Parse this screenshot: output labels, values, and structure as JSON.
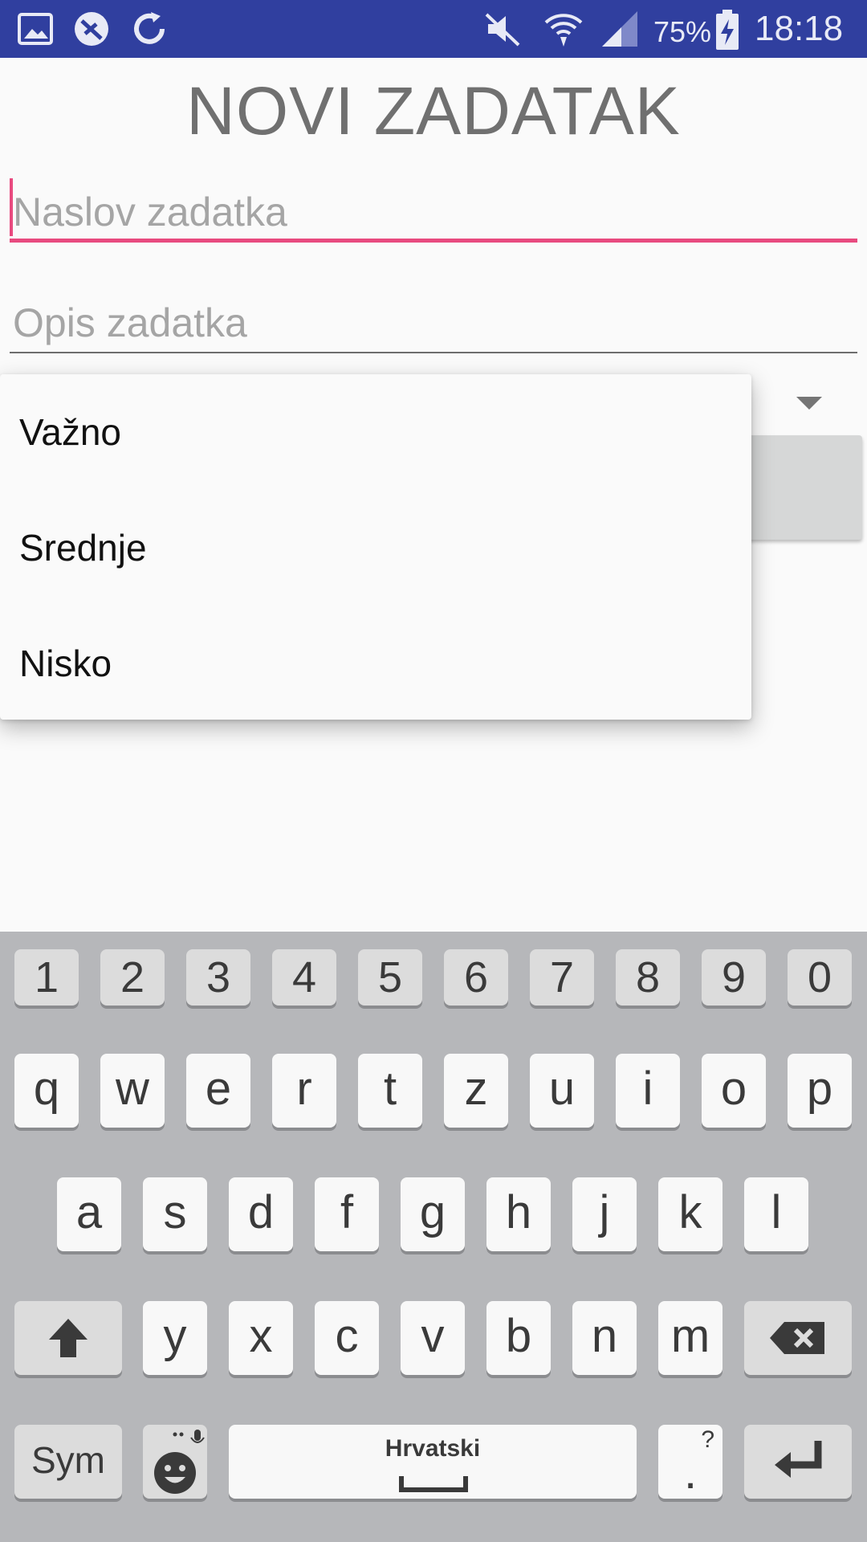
{
  "status_bar": {
    "icons": [
      "gallery-icon",
      "sync-off-icon",
      "refresh-icon",
      "mute-icon",
      "wifi-icon",
      "signal-icon",
      "battery-charging-icon"
    ],
    "battery_percent": "75%",
    "time": "18:18",
    "background_color": "#303f9f"
  },
  "page": {
    "title": "NOVI ZADATAK"
  },
  "form": {
    "title_field": {
      "placeholder": "Naslov zadatka",
      "value": "",
      "accent_color": "#e84a7f"
    },
    "description_field": {
      "placeholder": "Opis zadatka",
      "value": ""
    },
    "priority_spinner": {
      "options": [
        "Važno",
        "Srednje",
        "Nisko"
      ],
      "expanded": true
    }
  },
  "keyboard": {
    "number_row": [
      "1",
      "2",
      "3",
      "4",
      "5",
      "6",
      "7",
      "8",
      "9",
      "0"
    ],
    "row1": [
      "q",
      "w",
      "e",
      "r",
      "t",
      "z",
      "u",
      "i",
      "o",
      "p"
    ],
    "row2": [
      "a",
      "s",
      "d",
      "f",
      "g",
      "h",
      "j",
      "k",
      "l"
    ],
    "row3": [
      "y",
      "x",
      "c",
      "v",
      "b",
      "n",
      "m"
    ],
    "sym_label": "Sym",
    "space_label": "Hrvatski",
    "period_label": ".",
    "period_hint": "?",
    "icons": [
      "shift-icon",
      "backspace-icon",
      "emoji-icon",
      "microphone-icon",
      "enter-icon"
    ]
  }
}
